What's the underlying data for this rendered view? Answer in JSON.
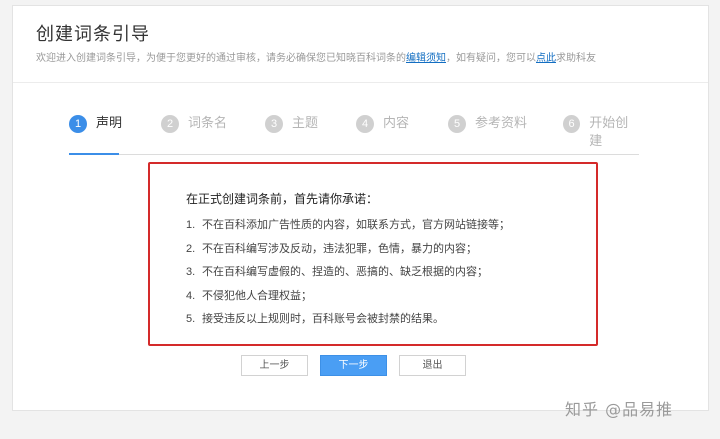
{
  "header": {
    "title": "创建词条引导",
    "intro_before": "欢迎进入创建词条引导，为便于您更好的通过审核，请务必确保您已知晓百科词条的",
    "intro_link1": "编辑须知",
    "intro_middle": "，如有疑问，您可以",
    "intro_link2": "点此",
    "intro_after": "求助科友"
  },
  "steps": [
    {
      "num": "1",
      "label": "声明"
    },
    {
      "num": "2",
      "label": "词条名"
    },
    {
      "num": "3",
      "label": "主题"
    },
    {
      "num": "4",
      "label": "内容"
    },
    {
      "num": "5",
      "label": "参考资料"
    },
    {
      "num": "6",
      "label": "开始创建"
    }
  ],
  "active_step": 1,
  "declaration": {
    "title": "在正式创建词条前，首先请你承诺：",
    "items": [
      {
        "idx": "1.",
        "text": "不在百科添加广告性质的内容，如联系方式，官方网站链接等；"
      },
      {
        "idx": "2.",
        "text": "不在百科编写涉及反动，违法犯罪，色情，暴力的内容；"
      },
      {
        "idx": "3.",
        "text": "不在百科编写虚假的、捏造的、恶搞的、缺乏根据的内容；"
      },
      {
        "idx": "4.",
        "text": "不侵犯他人合理权益；"
      },
      {
        "idx": "5.",
        "text": "接受违反以上规则时，百科账号会被封禁的结果。"
      }
    ]
  },
  "buttons": {
    "prev": "上一步",
    "next": "下一步",
    "exit": "退出"
  },
  "watermark": "知乎 @品易推",
  "colors": {
    "accent": "#3b8ee8",
    "highlight_border": "#d42a2a",
    "link": "#136ec2"
  }
}
